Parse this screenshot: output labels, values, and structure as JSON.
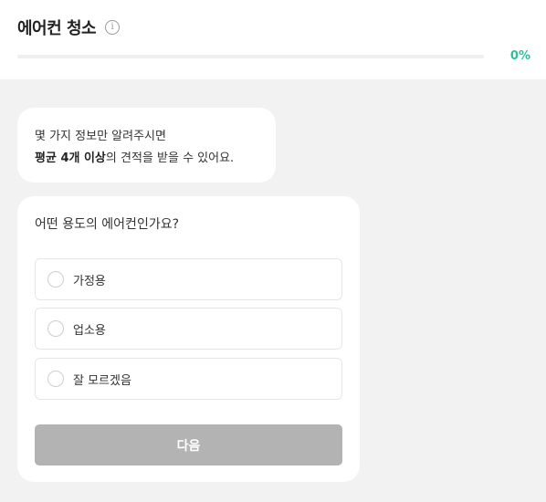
{
  "header": {
    "title": "에어컨 청소",
    "info_icon": "info-icon",
    "progress_percent": 0,
    "progress_label": "0%",
    "accent_color": "#2bbf9c"
  },
  "intro": {
    "line1": "몇 가지 정보만 알려주시면",
    "line2_bold": "평균 4개 이상",
    "line2_rest": "의 견적을 받을 수 있어요."
  },
  "question": {
    "text": "어떤 용도의 에어컨인가요?",
    "options": [
      {
        "label": "가정용",
        "selected": false
      },
      {
        "label": "업소용",
        "selected": false
      },
      {
        "label": "잘 모르겠음",
        "selected": false
      }
    ],
    "next_label": "다음",
    "next_enabled": false
  }
}
